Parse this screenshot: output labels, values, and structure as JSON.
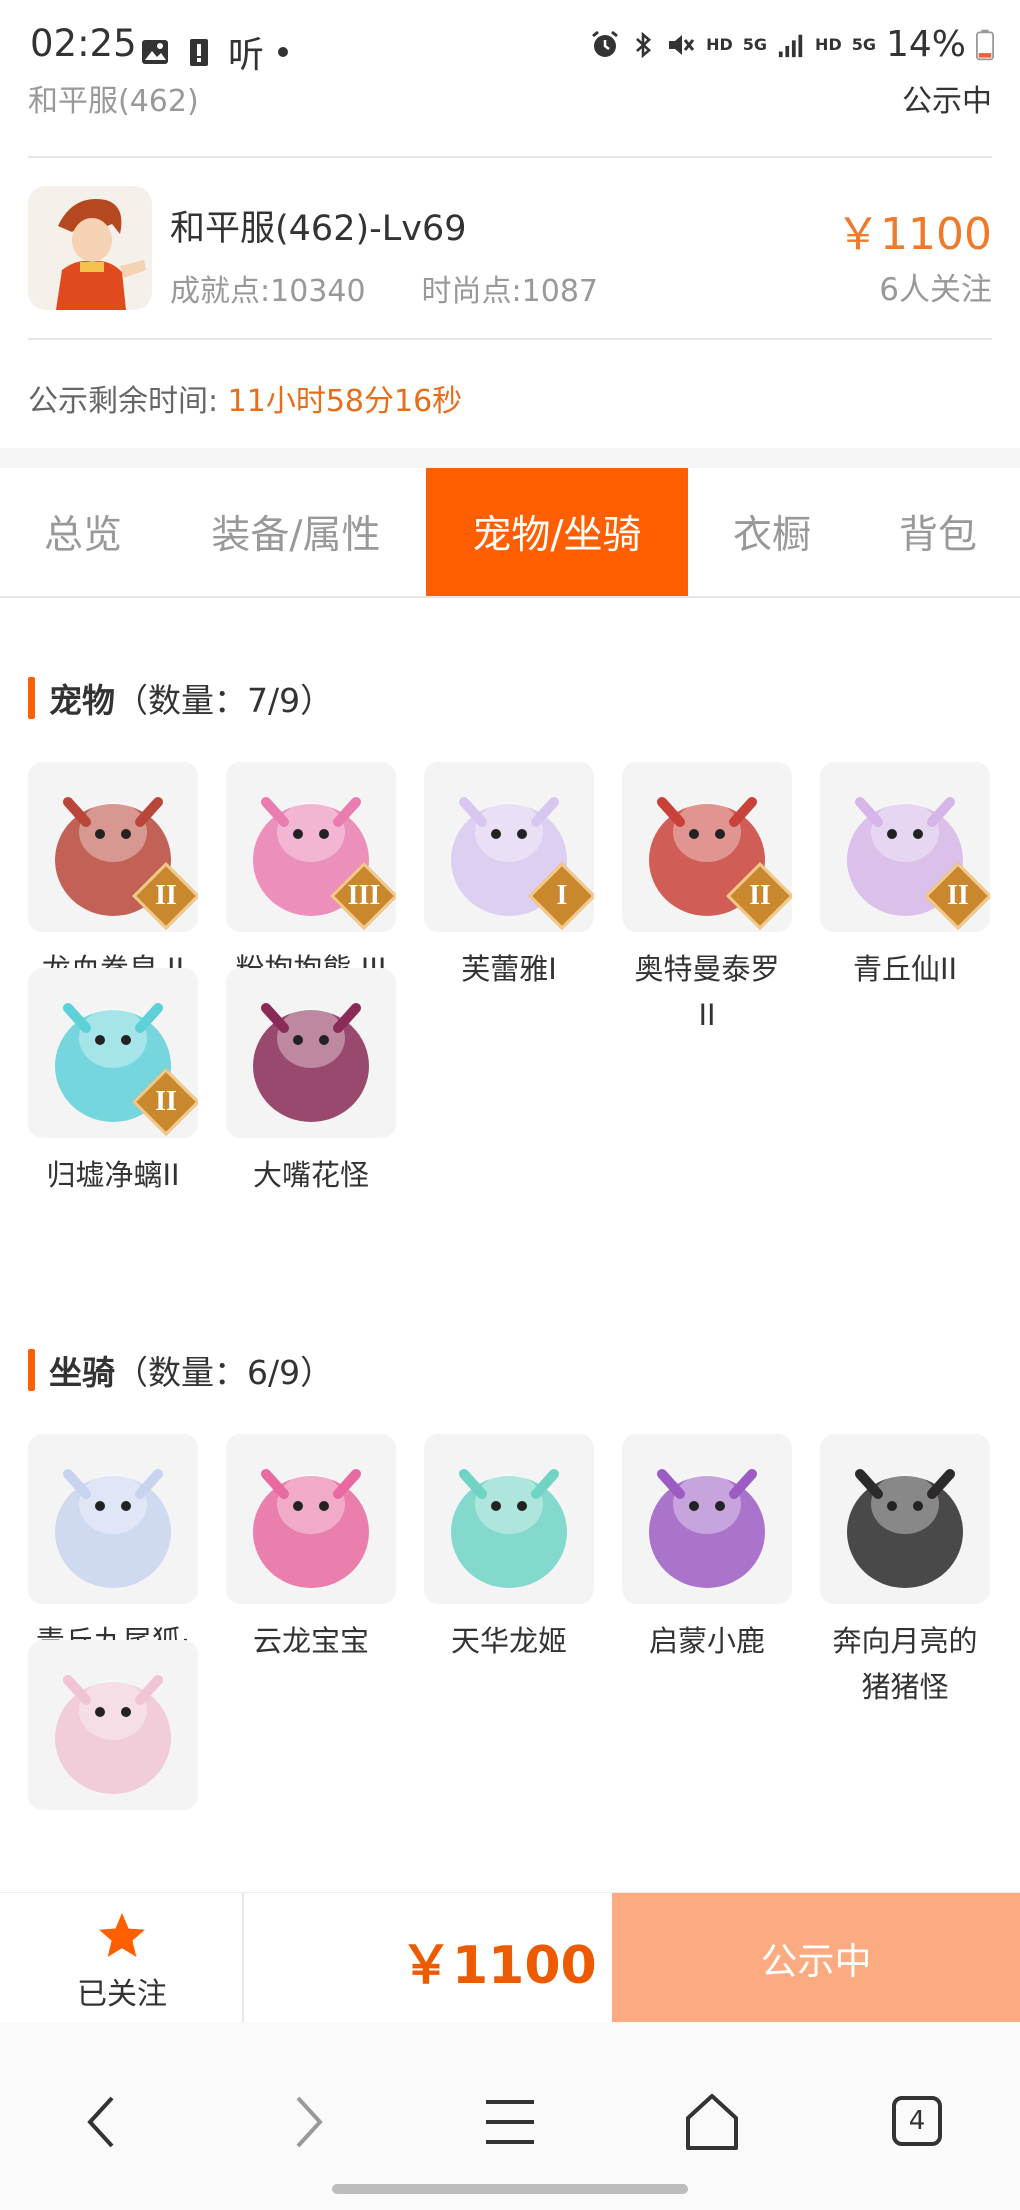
{
  "status_bar": {
    "time": "02:25",
    "left_icons": [
      "image-icon",
      "battery-alert-icon",
      "listen-app-icon",
      "dot-icon"
    ],
    "right_icons": [
      "alarm-icon",
      "bluetooth-icon",
      "mute-icon",
      "hd-icon",
      "5g-icon",
      "signal-icon",
      "hd-icon",
      "5g-signal-icon"
    ],
    "hd1": "HD",
    "hd2": "HD",
    "g5a": "5G",
    "g5b": "5G",
    "listen": "听",
    "battery": "14%"
  },
  "header": {
    "server_sub": "和平服(462)",
    "status_sub": "公示中"
  },
  "product": {
    "title": "和平服(462)-Lv69",
    "achievement": "成就点:10340",
    "fashion": "时尚点:1087",
    "price": "￥1100",
    "followers": "6人关注",
    "countdown_label": "公示剩余时间:",
    "countdown_value": "11小时58分16秒"
  },
  "tabs": [
    {
      "label": "总览",
      "active": false
    },
    {
      "label": "装备/属性",
      "active": false
    },
    {
      "label": "宠物/坐骑",
      "active": true
    },
    {
      "label": "衣橱",
      "active": false
    },
    {
      "label": "背包",
      "active": false
    }
  ],
  "pets": {
    "title": "宠物",
    "count": "（数量：7/9）",
    "items": [
      {
        "name": "龙血拳皇 II",
        "badge": "II",
        "color": "#b8473a"
      },
      {
        "name": "粉抱抱熊 III",
        "badge": "III",
        "color": "#ea7db0"
      },
      {
        "name": "芙蕾雅I",
        "badge": "I",
        "color": "#d8c8f0"
      },
      {
        "name": "奥特曼泰罗 II",
        "badge": "II",
        "color": "#c9423a"
      },
      {
        "name": "青丘仙II",
        "badge": "II",
        "color": "#d6b6e8"
      },
      {
        "name": "归墟净螭II",
        "badge": "II",
        "color": "#5ed0d8"
      },
      {
        "name": "大嘴花怪",
        "badge": "",
        "color": "#8a2a56"
      }
    ]
  },
  "mounts": {
    "title": "坐骑",
    "count": "（数量：6/9）",
    "items": [
      {
        "name": "青丘九尾狐·高",
        "color": "#c8d4ef"
      },
      {
        "name": "云龙宝宝",
        "color": "#e86aa0"
      },
      {
        "name": "天华龙姬",
        "color": "#6fd4c4"
      },
      {
        "name": "启蒙小鹿",
        "color": "#9c5cc4"
      },
      {
        "name": "奔向月亮的猪猪怪",
        "color": "#2c2a2a"
      },
      {
        "name": "",
        "color": "#f0c4d4"
      }
    ]
  },
  "bottom_bar": {
    "favorite_label": "已关注",
    "price": "￥1100",
    "action_label": "公示中"
  },
  "system_nav": {
    "tabs_count": "4"
  },
  "colors": {
    "accent": "#ff5f00",
    "price": "#ee7a2a",
    "button_disabled": "#fcaa80",
    "star": "#ff5f00"
  }
}
